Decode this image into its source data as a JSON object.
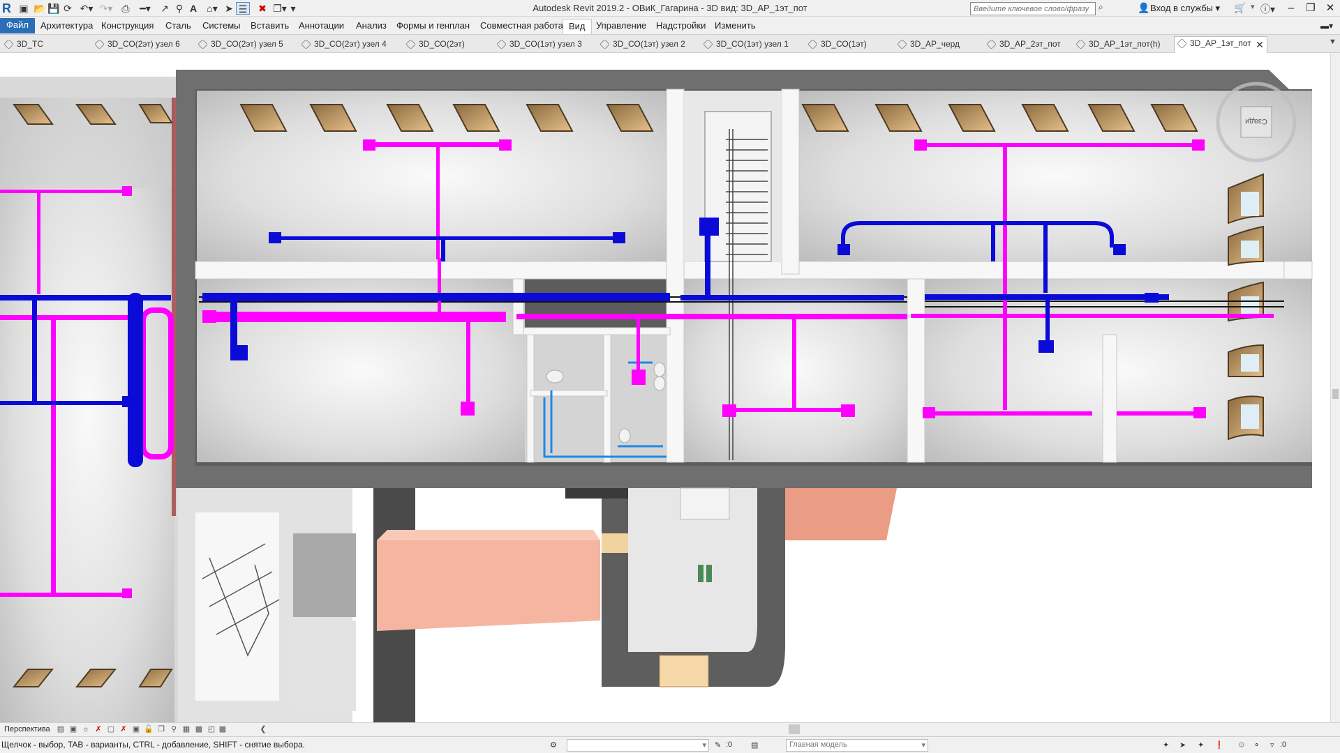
{
  "title": "Autodesk Revit 2019.2 - ОВиК_Гагарина - 3D вид: 3D_АР_1эт_пот",
  "search": {
    "placeholder": "Введите ключевое слово/фразу"
  },
  "account": {
    "signin": "Вход в службы"
  },
  "quick_access": {
    "icons": [
      "revit-logo-icon",
      "open-icon",
      "save-icon",
      "sync-icon",
      "undo-icon",
      "redo-icon",
      "print-icon",
      "measure-icon",
      "aligned-dimension-icon",
      "tag-icon",
      "text-icon",
      "default-3d-view-icon",
      "sections-icon",
      "thin-lines-icon",
      "close-hidden-icon",
      "switch-windows-icon",
      "customize-icon"
    ]
  },
  "ribbon": {
    "tabs": [
      {
        "label": "Файл"
      },
      {
        "label": "Архитектура"
      },
      {
        "label": "Конструкция"
      },
      {
        "label": "Сталь"
      },
      {
        "label": "Системы"
      },
      {
        "label": "Вставить"
      },
      {
        "label": "Аннотации"
      },
      {
        "label": "Анализ"
      },
      {
        "label": "Формы и генплан"
      },
      {
        "label": "Совместная работа"
      },
      {
        "label": "Вид"
      },
      {
        "label": "Управление"
      },
      {
        "label": "Надстройки"
      },
      {
        "label": "Изменить"
      }
    ],
    "active_tab": "Вид"
  },
  "view_tabs": [
    {
      "label": "3D_ТС"
    },
    {
      "label": "3D_СО(2эт) узел 6"
    },
    {
      "label": "3D_СО(2эт) узел 5"
    },
    {
      "label": "3D_СО(2эт) узел 4"
    },
    {
      "label": "3D_СО(2эт)"
    },
    {
      "label": "3D_СО(1эт) узел 3"
    },
    {
      "label": "3D_СО(1эт) узел 2"
    },
    {
      "label": "3D_СО(1эт) узел 1"
    },
    {
      "label": "3D_СО(1эт)"
    },
    {
      "label": "3D_АР_черд"
    },
    {
      "label": "3D_АР_2эт_пот"
    },
    {
      "label": "3D_АР_1эт_пот(h)"
    },
    {
      "label": "3D_АР_1эт_пот"
    }
  ],
  "active_view": "3D_АР_1эт_пот",
  "viewcube": {
    "face_label": "Сзади"
  },
  "view_control_bar": {
    "view_type": "Перспектива"
  },
  "status_bar": {
    "hint": "Щелчок - выбор, TAB - варианты, CTRL - добавление, SHIFT - снятие выбора.",
    "selection_count": ":0",
    "model": "Главная модель",
    "filter_count": ":0"
  },
  "colors": {
    "supply_duct": "#ff00ff",
    "exhaust_duct": "#0b0bd8",
    "water_pipe": "#1e88e5",
    "walls": "#6a6a6a",
    "floor": "#e4e4e4",
    "ribbon_file": "#2a6fb6",
    "insulation_block": "#f3b29c"
  }
}
